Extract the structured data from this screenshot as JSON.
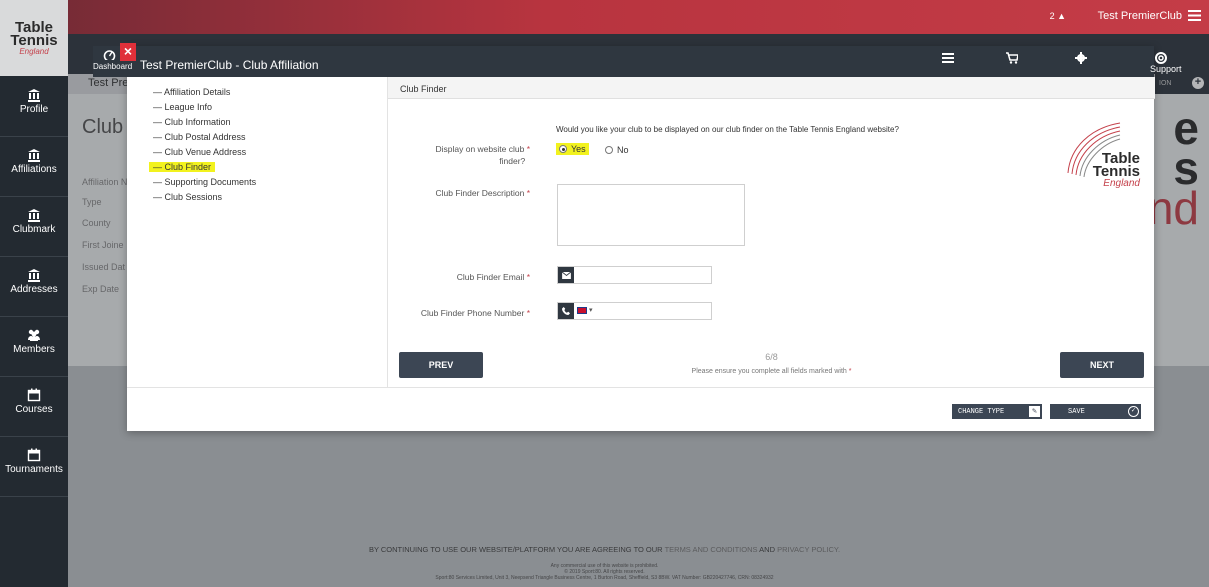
{
  "topbar": {
    "count": "2",
    "user": "Test PremierClub"
  },
  "logo": {
    "line1": "Table",
    "line2": "Tennis",
    "line3": "England"
  },
  "sidebar": {
    "items": [
      {
        "label": "Profile"
      },
      {
        "label": "Affiliations"
      },
      {
        "label": "Clubmark"
      },
      {
        "label": "Addresses"
      },
      {
        "label": "Members"
      },
      {
        "label": "Courses"
      },
      {
        "label": "Tournaments"
      }
    ]
  },
  "page": {
    "breadcrumb": "Test Pre",
    "club_title": "Club",
    "labels": [
      "Affiliation N",
      "Type",
      "County",
      "First Joine",
      "Issued Dat",
      "Exp Date"
    ],
    "right_btn": "ION",
    "big_letters": [
      "e",
      "s",
      "nd"
    ]
  },
  "modal": {
    "dashboard_label": "Dashboard",
    "title": "Test PremierClub - Club Affiliation",
    "support_label": "Support",
    "steps": [
      {
        "label": "Affiliation Details"
      },
      {
        "label": "League Info"
      },
      {
        "label": "Club Information"
      },
      {
        "label": "Club Postal Address"
      },
      {
        "label": "Club Venue Address"
      },
      {
        "label": "Club Finder"
      },
      {
        "label": "Supporting Documents"
      },
      {
        "label": "Club Sessions"
      }
    ],
    "section_title": "Club Finder",
    "question": "Would you like your club to be displayed on our club finder on the Table Tennis England website?",
    "display_label_1": "Display on website club",
    "display_label_2": "finder?",
    "radio_yes": "Yes",
    "radio_no": "No",
    "description_label": "Club Finder Description",
    "description_value": "",
    "email_label": "Club Finder Email",
    "email_value": "",
    "phone_label": "Club Finder Phone Number",
    "phone_value": "",
    "required_mark": "*",
    "prev_label": "PREV",
    "next_label": "NEXT",
    "progress": "6/8",
    "note": "Please ensure you complete all fields marked with",
    "change_type_label": "CHANGE TYPE",
    "save_label": "SAVE"
  },
  "footer": {
    "line1_pre": "BY CONTINUING TO USE OUR WEBSITE/PLATFORM YOU ARE AGREEING TO OUR",
    "terms_link": "TERMS AND CONDITIONS",
    "and": "AND",
    "privacy_link": "PRIVACY POLICY.",
    "small1": "Any commercial use of this website is prohibited.",
    "small2": "© 2019 Sport:80. All rights reserved.",
    "small3": "Sport:80 Services Limited, Unit 3, Neepsend Triangle Business Centre, 1 Burton Road, Sheffield, S3 8BW. VAT Number: GB220427746, CRN: 08324932"
  },
  "colors": {
    "accent": "#c4414b",
    "dark": "#2f3740",
    "highlight": "#f2f21e"
  }
}
